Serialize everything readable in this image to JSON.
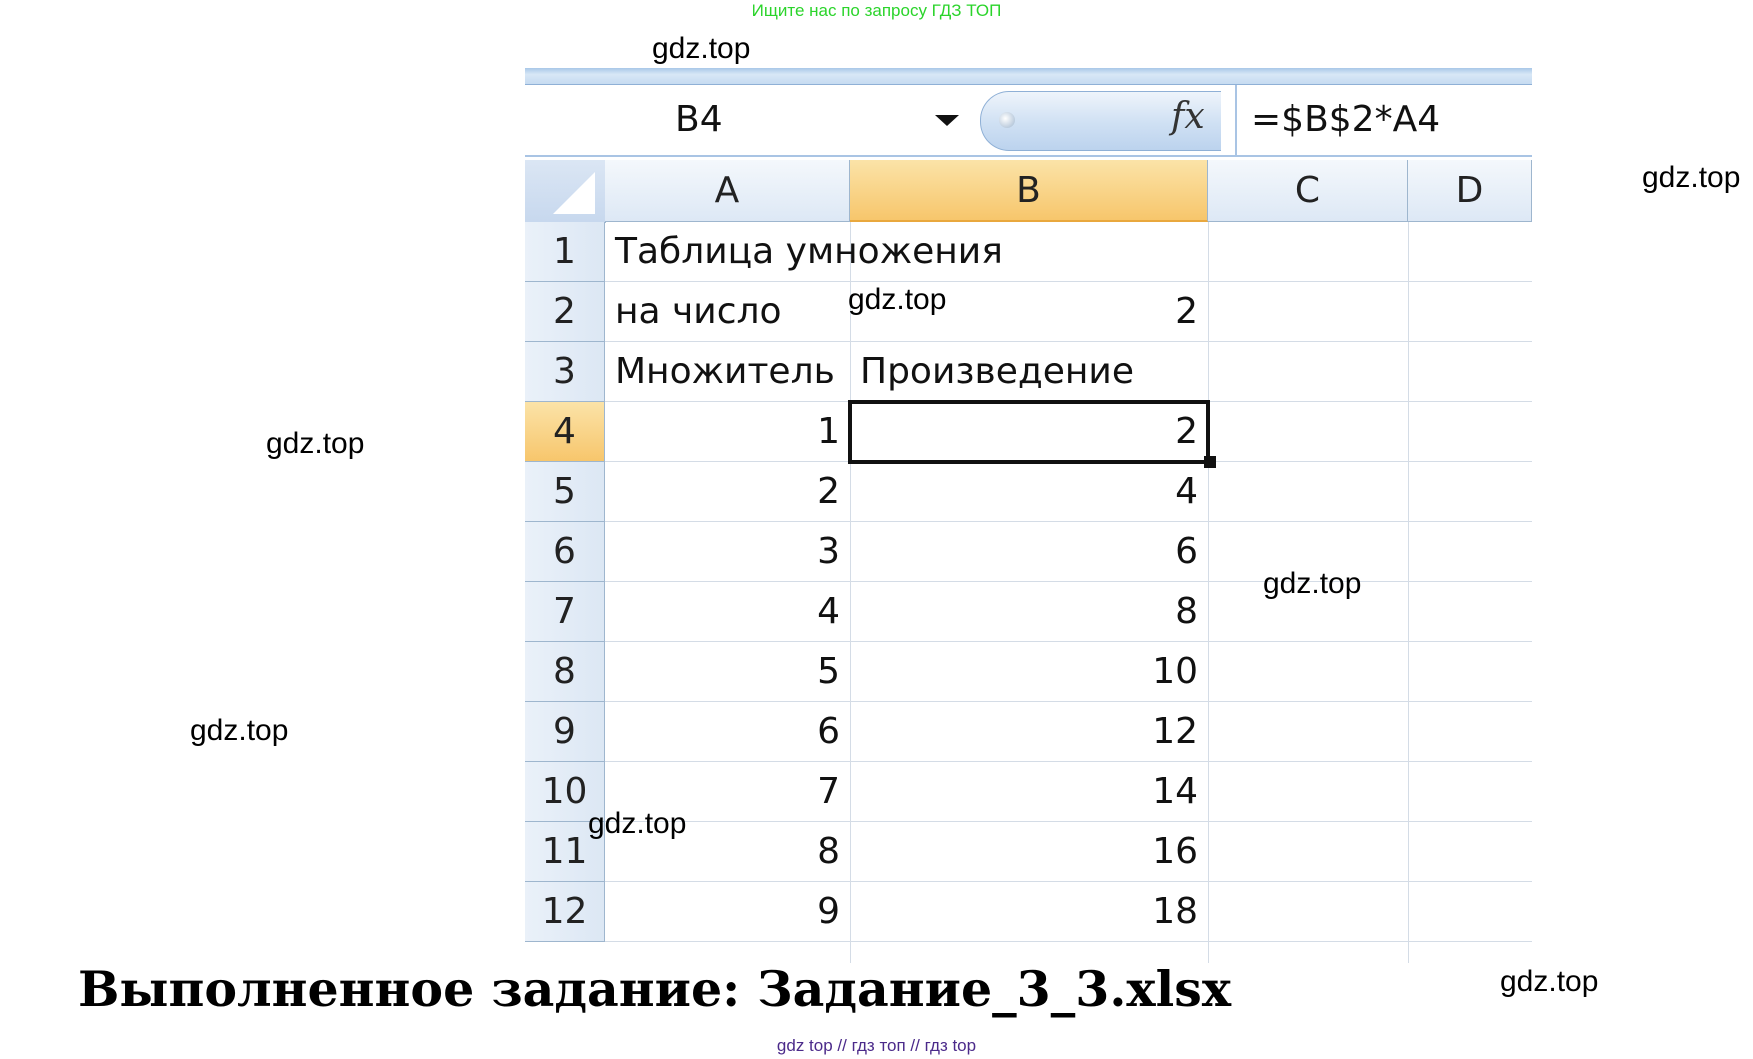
{
  "promo_text": "Ищите нас по запросу ГДЗ ТОП",
  "watermarks": [
    "gdz.top",
    "gdz.top",
    "gdz.top",
    "gdz.top",
    "gdz.top",
    "gdz.top",
    "gdz.top",
    "gdz.top"
  ],
  "formula_bar": {
    "name_box": "B4",
    "fx_icon": "fx-icon",
    "formula": "=$B$2*A4"
  },
  "sheet": {
    "columns": [
      "A",
      "B",
      "C",
      "D"
    ],
    "active_column": "B",
    "active_row": "4",
    "rows": [
      {
        "num": "1",
        "a": "Таблица умножения",
        "b": ""
      },
      {
        "num": "2",
        "a": "на число",
        "b": "2"
      },
      {
        "num": "3",
        "a": "Множитель",
        "b": "Произведение"
      },
      {
        "num": "4",
        "a": "1",
        "b": "2"
      },
      {
        "num": "5",
        "a": "2",
        "b": "4"
      },
      {
        "num": "6",
        "a": "3",
        "b": "6"
      },
      {
        "num": "7",
        "a": "4",
        "b": "8"
      },
      {
        "num": "8",
        "a": "5",
        "b": "10"
      },
      {
        "num": "9",
        "a": "6",
        "b": "12"
      },
      {
        "num": "10",
        "a": "7",
        "b": "14"
      },
      {
        "num": "11",
        "a": "8",
        "b": "16"
      },
      {
        "num": "12",
        "a": "9",
        "b": "18"
      }
    ]
  },
  "caption": "Выполненное задание: Задание_3_3.xlsx",
  "footer": "gdz top  //  гдз топ  //  гдз top",
  "colors": {
    "header_blue": "#dde8f5",
    "active_header": "#f7c66c",
    "promo_green": "#2bd42b",
    "footer_purple": "#4b2a8a"
  }
}
